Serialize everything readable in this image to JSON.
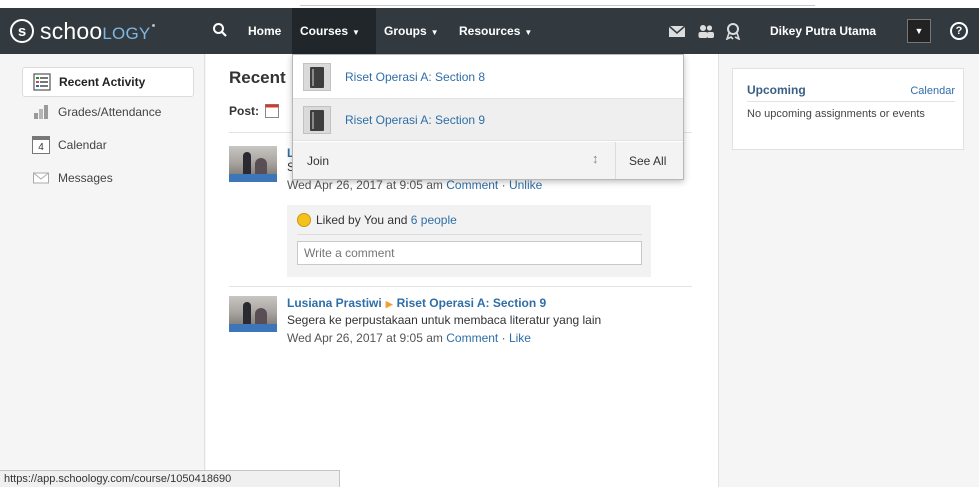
{
  "header": {
    "logo_prefix": "s",
    "logo_text_main": "schoo",
    "logo_text_accent": "logy",
    "nav": {
      "home": "Home",
      "courses": "Courses",
      "groups": "Groups",
      "resources": "Resources"
    },
    "user_name": "Dikey Putra Utama",
    "help": "?"
  },
  "sidebar": {
    "items": [
      {
        "label": "Recent Activity",
        "icon": "recent-activity-icon"
      },
      {
        "label": "Grades/Attendance",
        "icon": "grades-icon"
      },
      {
        "label": "Calendar",
        "icon": "calendar-icon",
        "day": "4"
      },
      {
        "label": "Messages",
        "icon": "envelope-icon"
      }
    ]
  },
  "main": {
    "title": "Recent",
    "post_label": "Post:",
    "feed": [
      {
        "author": "L",
        "text": "S",
        "meta_time": "Wed Apr 26, 2017 at 9:05 am",
        "action_comment": "Comment",
        "action_like": "Unlike",
        "likes_prefix": "Liked by You and",
        "likes_link": "6 people",
        "comment_placeholder": "Write a comment"
      },
      {
        "author": "Lusiana Prastiwi",
        "course": "Riset Operasi A: Section 9",
        "text": "Segera ke perpustakaan untuk membaca literatur yang lain",
        "meta_time": "Wed Apr 26, 2017 at 9:05 am",
        "action_comment": "Comment",
        "action_like": "Like"
      }
    ]
  },
  "upcoming": {
    "title": "Upcoming",
    "calendar_link": "Calendar",
    "empty_text": "No upcoming assignments or events"
  },
  "courses_dropdown": {
    "items": [
      {
        "label": "Riset Operasi A: Section 8"
      },
      {
        "label": "Riset Operasi A: Section 9"
      }
    ],
    "join": "Join",
    "see_all": "See All"
  },
  "status_url": "https://app.schoology.com/course/1050418690",
  "colors": {
    "header_bg": "#333a3f",
    "link": "#2f6ea7",
    "accent_arrow": "#f0a030"
  }
}
